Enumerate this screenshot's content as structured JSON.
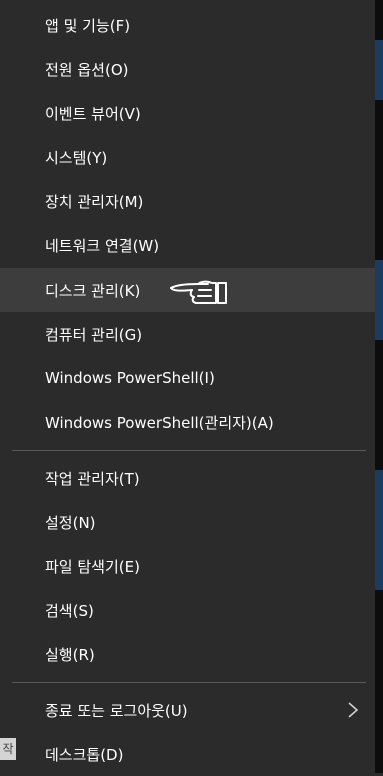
{
  "menu": {
    "items": [
      {
        "label": "앱 및 기능(F)"
      },
      {
        "label": "전원 옵션(O)"
      },
      {
        "label": "이벤트 뷰어(V)"
      },
      {
        "label": "시스템(Y)"
      },
      {
        "label": "장치 관리자(M)"
      },
      {
        "label": "네트워크 연결(W)"
      },
      {
        "label": "디스크 관리(K)"
      },
      {
        "label": "컴퓨터 관리(G)"
      },
      {
        "label": "Windows PowerShell(I)"
      },
      {
        "label": "Windows PowerShell(관리자)(A)"
      },
      {
        "label": "작업 관리자(T)"
      },
      {
        "label": "설정(N)"
      },
      {
        "label": "파일 탐색기(E)"
      },
      {
        "label": "검색(S)"
      },
      {
        "label": "실행(R)"
      },
      {
        "label": "종료 또는 로그아웃(U)"
      },
      {
        "label": "데스크톱(D)"
      }
    ]
  },
  "background_tab": {
    "label": "작"
  },
  "icons": {
    "pointer": "pointing-hand-icon",
    "submenu": "chevron-right-icon"
  },
  "colors": {
    "menu_bg": "#2b2b2b",
    "hover_bg": "#3d3d3d",
    "text": "#ffffff",
    "separator": "#5a5a5a"
  }
}
